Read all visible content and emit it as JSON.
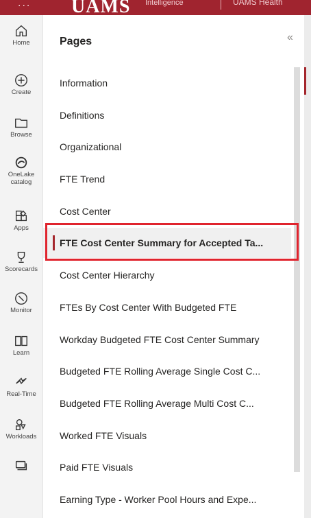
{
  "header": {
    "menu_glyph": "...",
    "logo_text": "UAMS",
    "logo_subtext": "Intelligence",
    "right_text": "UAMS Health"
  },
  "rail": {
    "items": [
      {
        "label": "Home",
        "icon": "home-icon"
      },
      {
        "label": "Create",
        "icon": "plus-circle-icon"
      },
      {
        "label": "Browse",
        "icon": "folder-icon"
      },
      {
        "label": "OneLake catalog",
        "icon": "onelake-icon"
      },
      {
        "label": "Apps",
        "icon": "apps-icon"
      },
      {
        "label": "Scorecards",
        "icon": "trophy-icon"
      },
      {
        "label": "Monitor",
        "icon": "monitor-icon"
      },
      {
        "label": "Learn",
        "icon": "book-icon"
      },
      {
        "label": "Real-Time",
        "icon": "lightning-icon"
      },
      {
        "label": "Workloads",
        "icon": "workloads-icon"
      },
      {
        "label": "",
        "icon": "workspaces-icon"
      }
    ]
  },
  "panel": {
    "title": "Pages",
    "collapse_glyph": "«",
    "pages": [
      {
        "label": "Information"
      },
      {
        "label": "Definitions"
      },
      {
        "label": "Organizational"
      },
      {
        "label": "FTE Trend"
      },
      {
        "label": "Cost Center"
      },
      {
        "label": "FTE Cost Center Summary for Accepted Ta...",
        "active": true
      },
      {
        "label": "Cost Center Hierarchy"
      },
      {
        "label": "FTEs By Cost Center With Budgeted FTE"
      },
      {
        "label": "Workday Budgeted FTE Cost Center Summary"
      },
      {
        "label": "Budgeted FTE Rolling Average Single Cost C..."
      },
      {
        "label": "Budgeted FTE Rolling Average Multi Cost C..."
      },
      {
        "label": "Worked FTE Visuals"
      },
      {
        "label": "Paid FTE Visuals"
      },
      {
        "label": "Earning Type - Worker Pool Hours and Expe..."
      }
    ]
  },
  "colors": {
    "brand": "#a0242f",
    "active_marker": "#a4262c",
    "annotation_box": "#e0242e"
  }
}
